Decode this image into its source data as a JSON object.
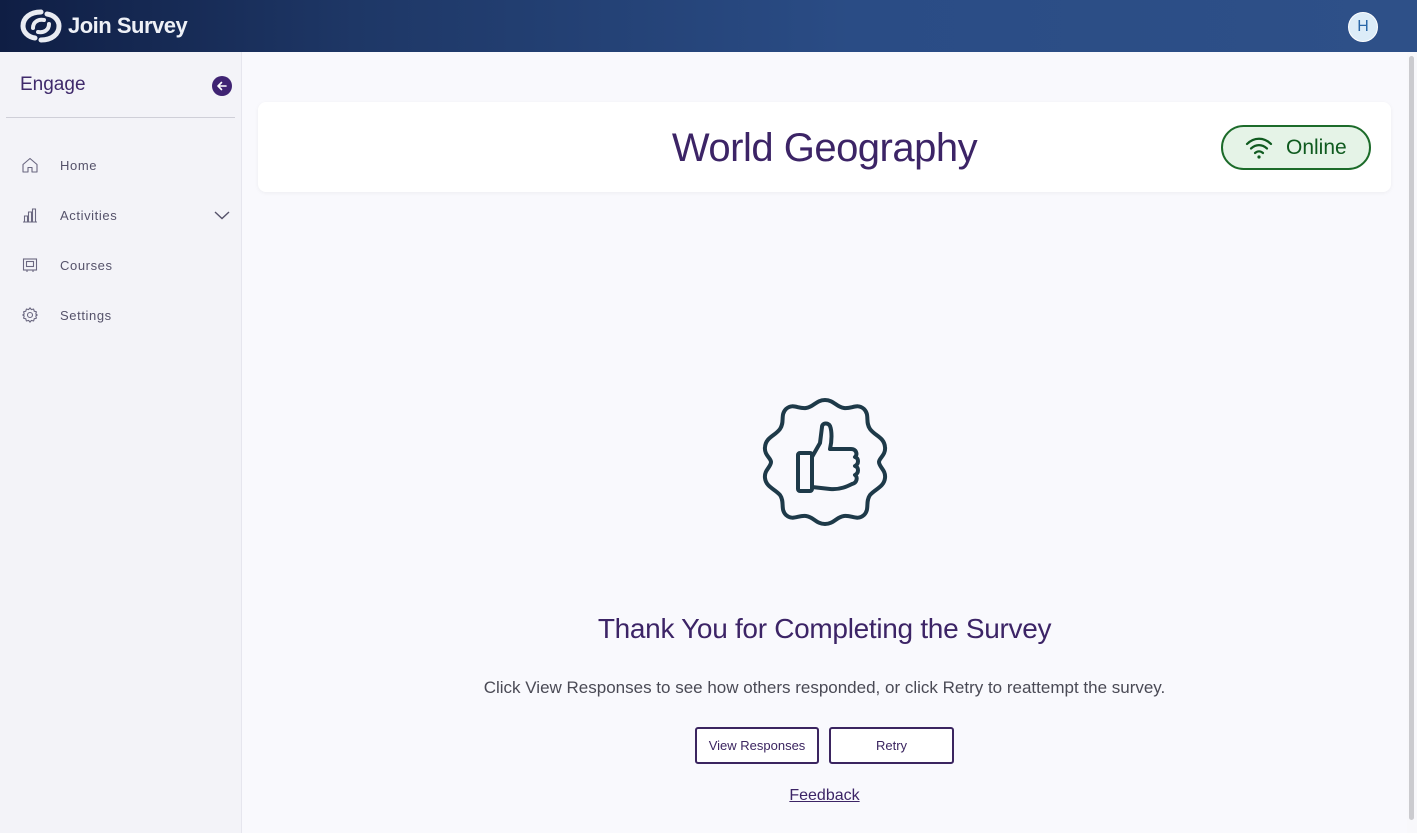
{
  "header": {
    "app_name": "Join Survey",
    "avatar_initial": "H"
  },
  "sidebar": {
    "title": "Engage",
    "items": [
      {
        "label": "Home",
        "icon": "home-icon"
      },
      {
        "label": "Activities",
        "icon": "bar-chart-icon",
        "expandable": true
      },
      {
        "label": "Courses",
        "icon": "courses-icon"
      },
      {
        "label": "Settings",
        "icon": "gear-icon"
      }
    ]
  },
  "card": {
    "title": "World Geography",
    "status": "Online"
  },
  "completion": {
    "icon": "thumbs-up-badge-icon",
    "title": "Thank You for Completing the Survey",
    "message": "Click View Responses to see how others responded, or click Retry to reattempt the survey.",
    "view_responses_label": "View Responses",
    "retry_label": "Retry",
    "feedback_label": "Feedback"
  },
  "colors": {
    "brand_dark": "#0f1e44",
    "brand_mid": "#2e5088",
    "accent_purple": "#3c2466",
    "online_green": "#1c6b2a",
    "online_bg": "#e5f3e7"
  }
}
